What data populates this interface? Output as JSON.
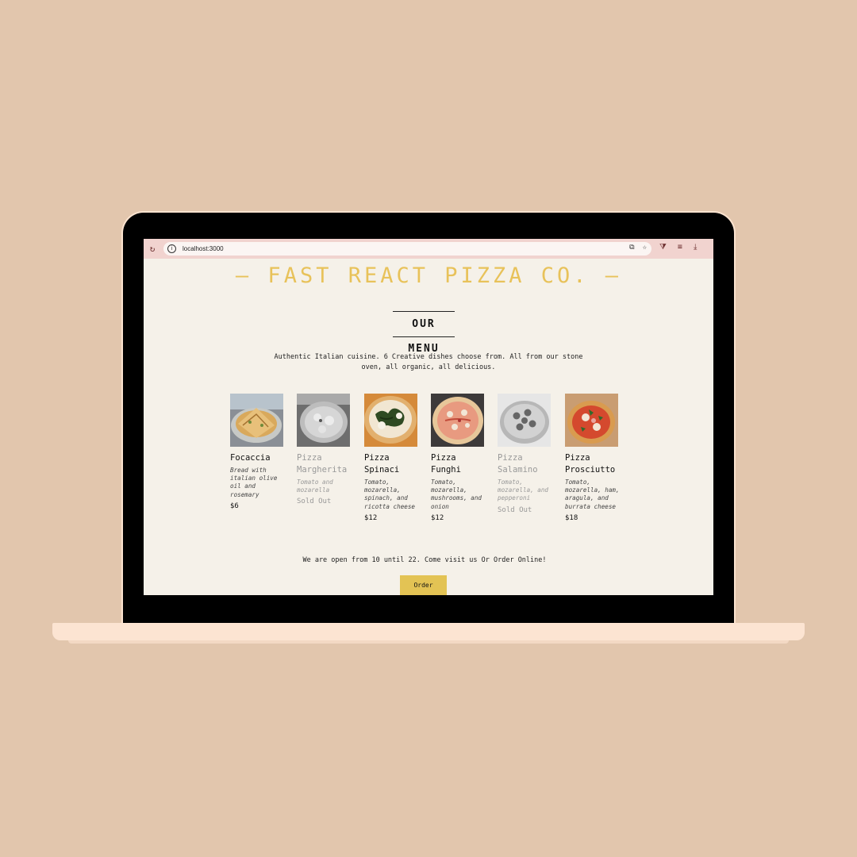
{
  "browser": {
    "url": "localhost:3000",
    "reload_icon": "↻",
    "info_icon": "i",
    "right_icons": [
      "⧉",
      "☆"
    ],
    "toolbar_icons": [
      "⧩",
      "≡",
      "⤓"
    ]
  },
  "header": {
    "logo": "— FAST REACT PIZZA CO. —"
  },
  "menu": {
    "title": "OUR MENU",
    "intro": "Authentic Italian cuisine. 6 Creative dishes choose from. All from our stone oven, all organic, all delicious.",
    "items": [
      {
        "name": "Focaccia",
        "description": "Bread with italian olive oil and rosemary",
        "price": "$6",
        "sold_out": false
      },
      {
        "name": "Pizza Margherita",
        "description": "Tomato and mozarella",
        "price": "Sold Out",
        "sold_out": true
      },
      {
        "name": "Pizza Spinaci",
        "description": "Tomato, mozarella, spinach, and ricotta cheese",
        "price": "$12",
        "sold_out": false
      },
      {
        "name": "Pizza Funghi",
        "description": "Tomato, mozarella, mushrooms, and onion",
        "price": "$12",
        "sold_out": false
      },
      {
        "name": "Pizza Salamino",
        "description": "Tomato, mozarella, and pepperoni",
        "price": "Sold Out",
        "sold_out": true
      },
      {
        "name": "Pizza Prosciutto",
        "description": "Tomato, mozarella, ham, aragula, and burrata cheese",
        "price": "$18",
        "sold_out": false
      }
    ]
  },
  "footer": {
    "text": "We are open from 10 until 22. Come visit us Or Order Online!",
    "order_label": "Order"
  },
  "colors": {
    "background": "#e2c6ad",
    "page": "#f5f1e9",
    "accent": "#e3c354",
    "logo": "#e8c25a",
    "browser_bar": "#f1d3cf"
  }
}
